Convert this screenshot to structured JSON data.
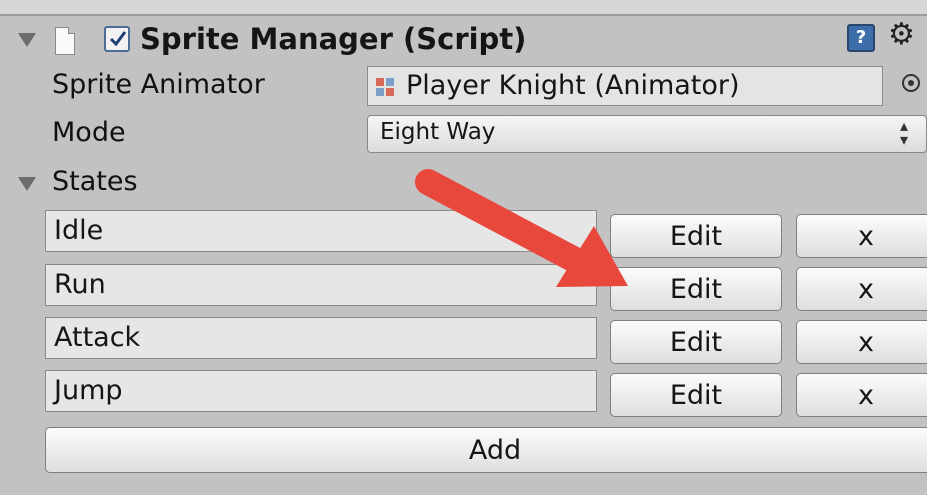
{
  "component": {
    "title": "Sprite Manager (Script)",
    "enabled": true,
    "help_glyph": "?",
    "gear_glyph": "⚙"
  },
  "fields": {
    "sprite_animator_label": "Sprite Animator",
    "sprite_animator_value": "Player Knight (Animator)",
    "mode_label": "Mode",
    "mode_value": "Eight Way"
  },
  "states": {
    "label": "States",
    "items": [
      {
        "name": "Idle",
        "edit_label": "Edit",
        "remove_label": "x"
      },
      {
        "name": "Run",
        "edit_label": "Edit",
        "remove_label": "x"
      },
      {
        "name": "Attack",
        "edit_label": "Edit",
        "remove_label": "x"
      },
      {
        "name": "Jump",
        "edit_label": "Edit",
        "remove_label": "x"
      }
    ],
    "add_label": "Add"
  },
  "icons": {
    "foldout": "foldout-triangle-icon",
    "script": "script-file-icon",
    "help": "help-icon",
    "gear": "gear-icon",
    "object_picker": "object-picker-icon",
    "annotation": "red-arrow-annotation"
  },
  "colors": {
    "panel_bg": "#c2c2c2",
    "checkbox_border": "#4c6c98",
    "help_blue": "#3d6ea9",
    "arrow_red": "#e8473b"
  }
}
